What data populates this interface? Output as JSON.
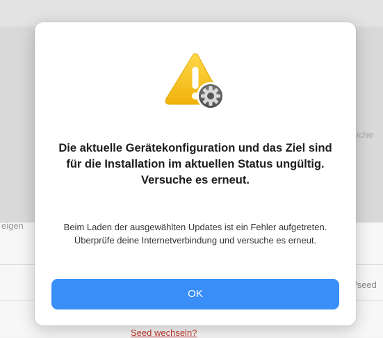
{
  "background": {
    "left_label": "eigen",
    "right_label": "liche",
    "right_url": "/seed",
    "link": "Seed wechseln?"
  },
  "dialog": {
    "icon": "warning-with-gear-icon",
    "title": "Die aktuelle Gerätekonfiguration und das Ziel sind für die Installation im aktuellen Status ungültig. Versuche es erneut.",
    "message": "Beim Laden der ausgewählten Updates ist ein Fehler aufgetreten. Überprüfe deine Internetverbindung und versuche es erneut.",
    "ok_label": "OK"
  },
  "colors": {
    "accent": "#3a8ef8",
    "warning": "#f5c518",
    "link": "#c0392b"
  }
}
